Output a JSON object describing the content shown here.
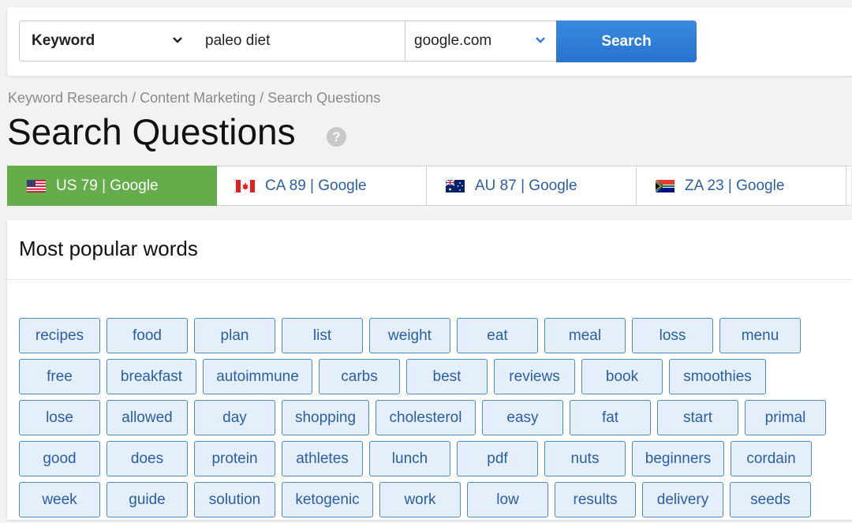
{
  "search": {
    "type_value": "Keyword",
    "query_value": "paleo diet",
    "database_value": "google.com",
    "button_label": "Search"
  },
  "breadcrumb": "Keyword Research / Content Marketing / Search Questions",
  "title": "Search Questions",
  "help_icon": "question-circle-icon",
  "tabs": [
    {
      "label": "US 79 | Google",
      "flag": "us-flag-icon",
      "active": true
    },
    {
      "label": "CA 89 | Google",
      "flag": "ca-flag-icon",
      "active": false
    },
    {
      "label": "AU 87 | Google",
      "flag": "au-flag-icon",
      "active": false
    },
    {
      "label": "ZA 23 | Google",
      "flag": "za-flag-icon",
      "active": false
    }
  ],
  "panel": {
    "title": "Most popular words",
    "words": [
      [
        "recipes",
        "food",
        "plan",
        "list",
        "weight",
        "eat",
        "meal",
        "loss",
        "menu"
      ],
      [
        "free",
        "breakfast",
        "autoimmune",
        "carbs",
        "best",
        "reviews",
        "book",
        "smoothies"
      ],
      [
        "lose",
        "allowed",
        "day",
        "shopping",
        "cholesterol",
        "easy",
        "fat",
        "start",
        "primal"
      ],
      [
        "good",
        "does",
        "protein",
        "athletes",
        "lunch",
        "pdf",
        "nuts",
        "beginners",
        "cordain"
      ],
      [
        "week",
        "guide",
        "solution",
        "ketogenic",
        "work",
        "low",
        "results",
        "delivery",
        "seeds"
      ]
    ]
  },
  "colors": {
    "accent": "#2d7ed8",
    "active_tab": "#65ad4b",
    "link": "#2a5fa6",
    "chip_bg": "#e5effc",
    "chip_border": "#4a8bc2"
  }
}
